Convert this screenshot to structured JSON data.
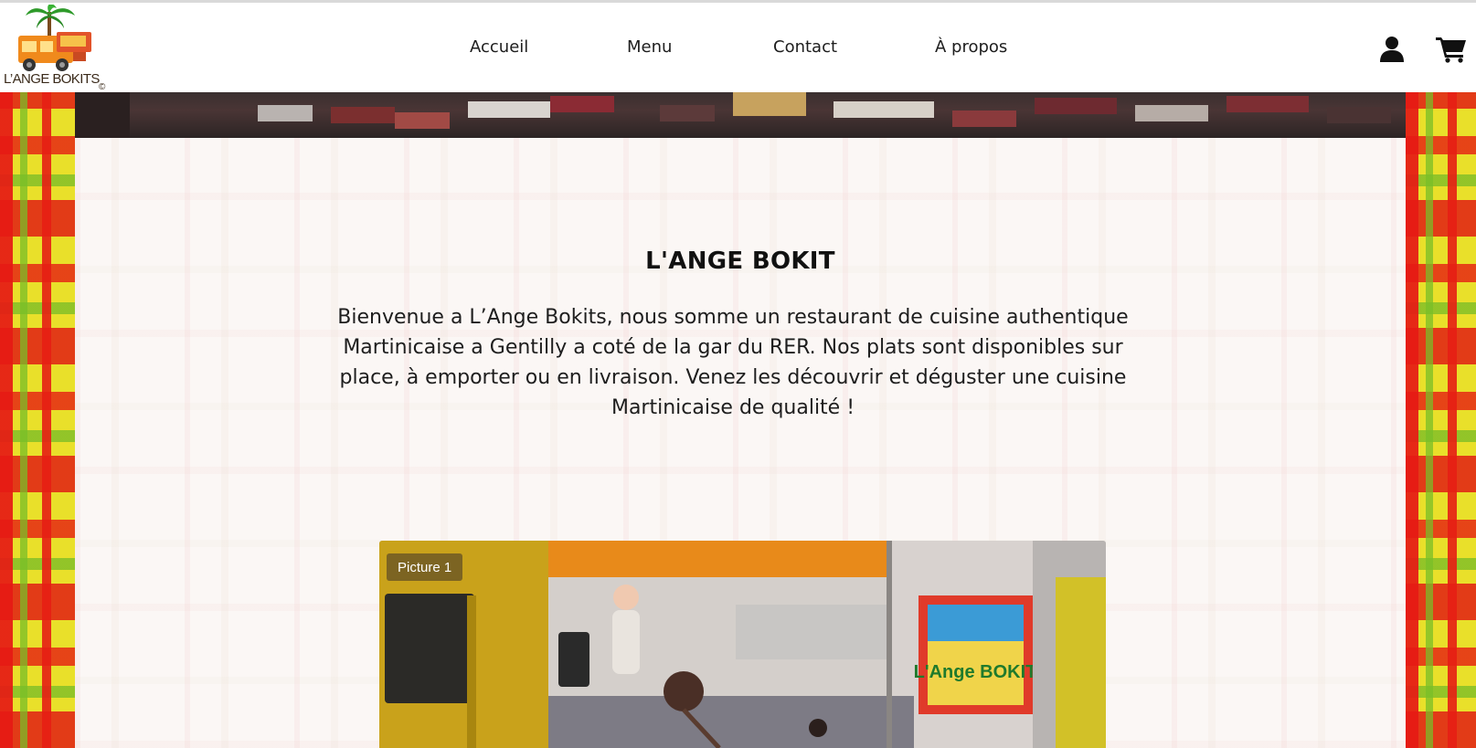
{
  "header": {
    "logo_text": "L’ANGE BOKITS",
    "logo_copyright": "©",
    "nav": [
      {
        "label": "Accueil"
      },
      {
        "label": "Menu"
      },
      {
        "label": "Contact"
      },
      {
        "label": "À propos"
      }
    ],
    "icons": {
      "account": "user-icon",
      "cart": "cart-icon"
    }
  },
  "main": {
    "title": "L'ANGE BOKIT",
    "intro": "Bienvenue a L’Ange Bokits, nous somme un restaurant de cuisine authentique Martinicaise a Gentilly a coté de la gar du RER. Nos plats sont disponibles sur place, à emporter ou en livraison. Venez les découvrir et déguster une cuisine Martinicaise de qualité !",
    "picture_caption": "Picture 1",
    "picture_sign_text": "L'Ange BOKIT"
  },
  "colors": {
    "madras_red": "#e61914",
    "madras_yellow": "#e9e02a",
    "madras_green": "#78be28",
    "content_bg": "#fbf7f5",
    "text": "#1e1e1e"
  }
}
